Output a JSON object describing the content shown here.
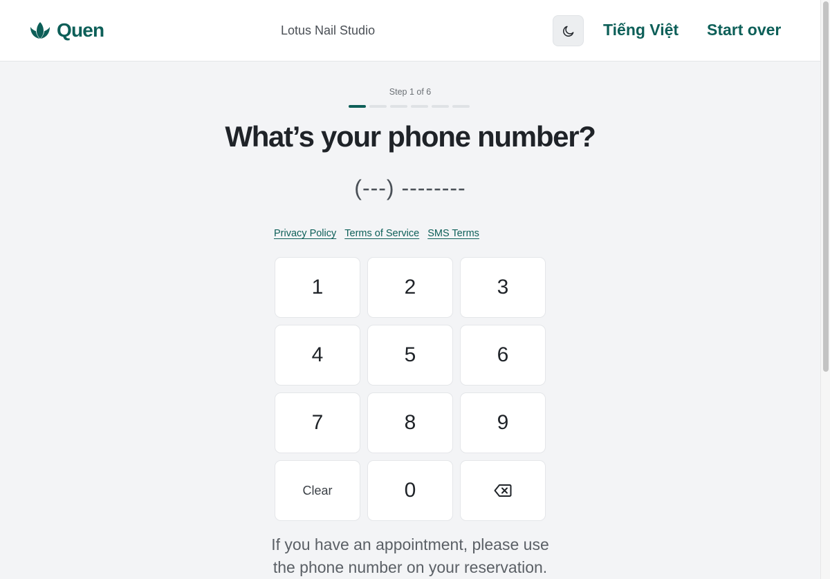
{
  "header": {
    "brand_name": "Quen",
    "salon_name": "Lotus Nail Studio",
    "language_label": "Tiếng Việt",
    "start_over_label": "Start over"
  },
  "step": {
    "label": "Step 1 of 6",
    "current": 1,
    "total": 6
  },
  "title": "What’s your phone number?",
  "phone_display": "(---) --------",
  "legal_links": [
    "Privacy Policy",
    "Terms of Service",
    "SMS Terms"
  ],
  "keypad": {
    "keys": [
      "1",
      "2",
      "3",
      "4",
      "5",
      "6",
      "7",
      "8",
      "9"
    ],
    "clear_label": "Clear",
    "zero_label": "0"
  },
  "hint_lines": [
    "If you have an appointment, please use",
    "the phone number on your reservation."
  ],
  "colors": {
    "accent": "#0d5f58",
    "background": "#f3f4f6"
  },
  "icons": {
    "logo": "lotus-icon",
    "theme_toggle": "moon-icon",
    "backspace": "backspace-icon"
  }
}
